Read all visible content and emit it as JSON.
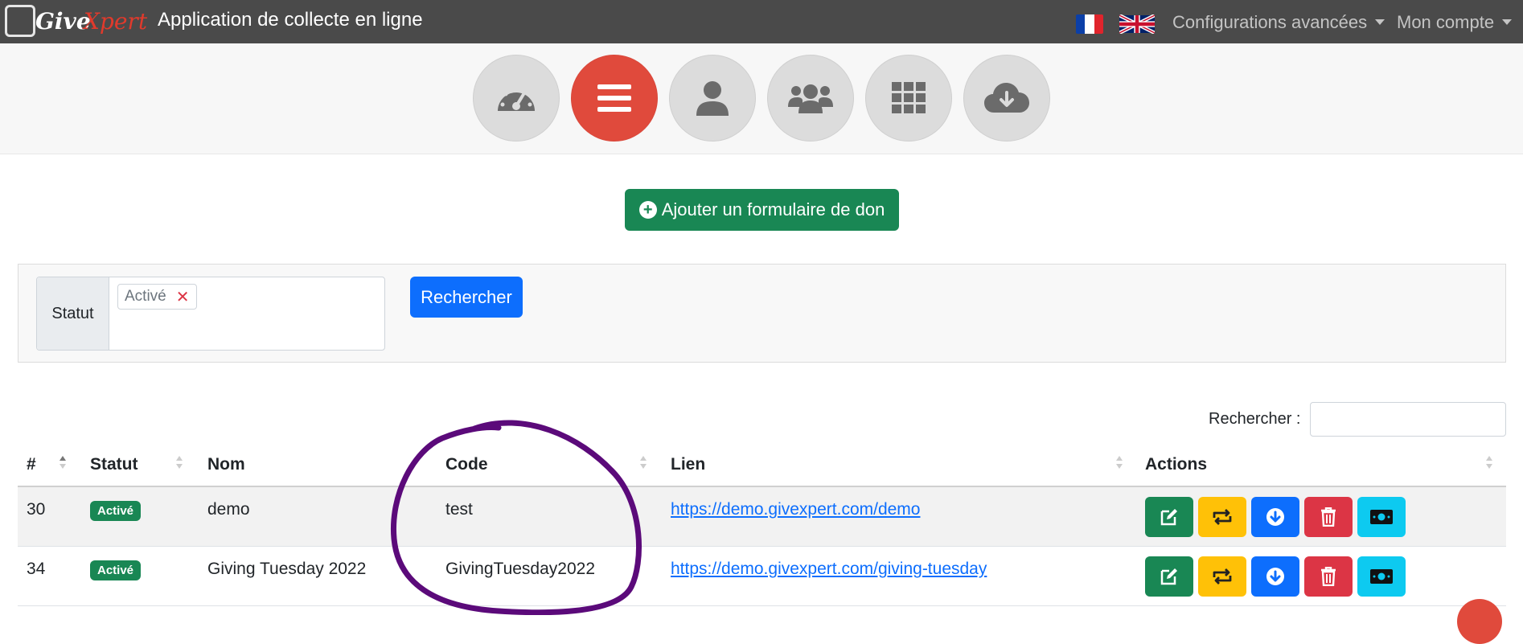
{
  "navbar": {
    "logo_give": "Give",
    "logo_xpert": "Xpert",
    "app_title": "Application de collecte en ligne",
    "advanced_config": "Configurations avancées",
    "account": "Mon compte"
  },
  "iconbar": {
    "icons": [
      "dashboard-icon",
      "list-icon",
      "user-icon",
      "users-icon",
      "grid-icon",
      "cloud-download-icon"
    ],
    "active_index": 1
  },
  "add_button": {
    "label": "Ajouter un formulaire de don"
  },
  "filter": {
    "status_label": "Statut",
    "selected_tag": "Activé",
    "tag_remove": "✕",
    "search_button": "Rechercher"
  },
  "table": {
    "search_label": "Rechercher :",
    "columns": [
      "#",
      "Statut",
      "Nom",
      "Code",
      "Lien",
      "Actions"
    ],
    "rows": [
      {
        "id": "30",
        "status": "Activé",
        "name": "demo",
        "code": "test",
        "link": "https://demo.givexpert.com/demo"
      },
      {
        "id": "34",
        "status": "Activé",
        "name": "Giving Tuesday 2022",
        "code": "GivingTuesday2022",
        "link": "https://demo.givexpert.com/giving-tuesday"
      }
    ]
  },
  "colors": {
    "navbar": "#4a4a4a",
    "active_circle": "#e04a3c",
    "success": "#198754",
    "primary": "#0d6efd",
    "warning": "#ffc107",
    "danger": "#dc3545",
    "info": "#0dcaf0",
    "annotation": "#5b0a7a"
  }
}
